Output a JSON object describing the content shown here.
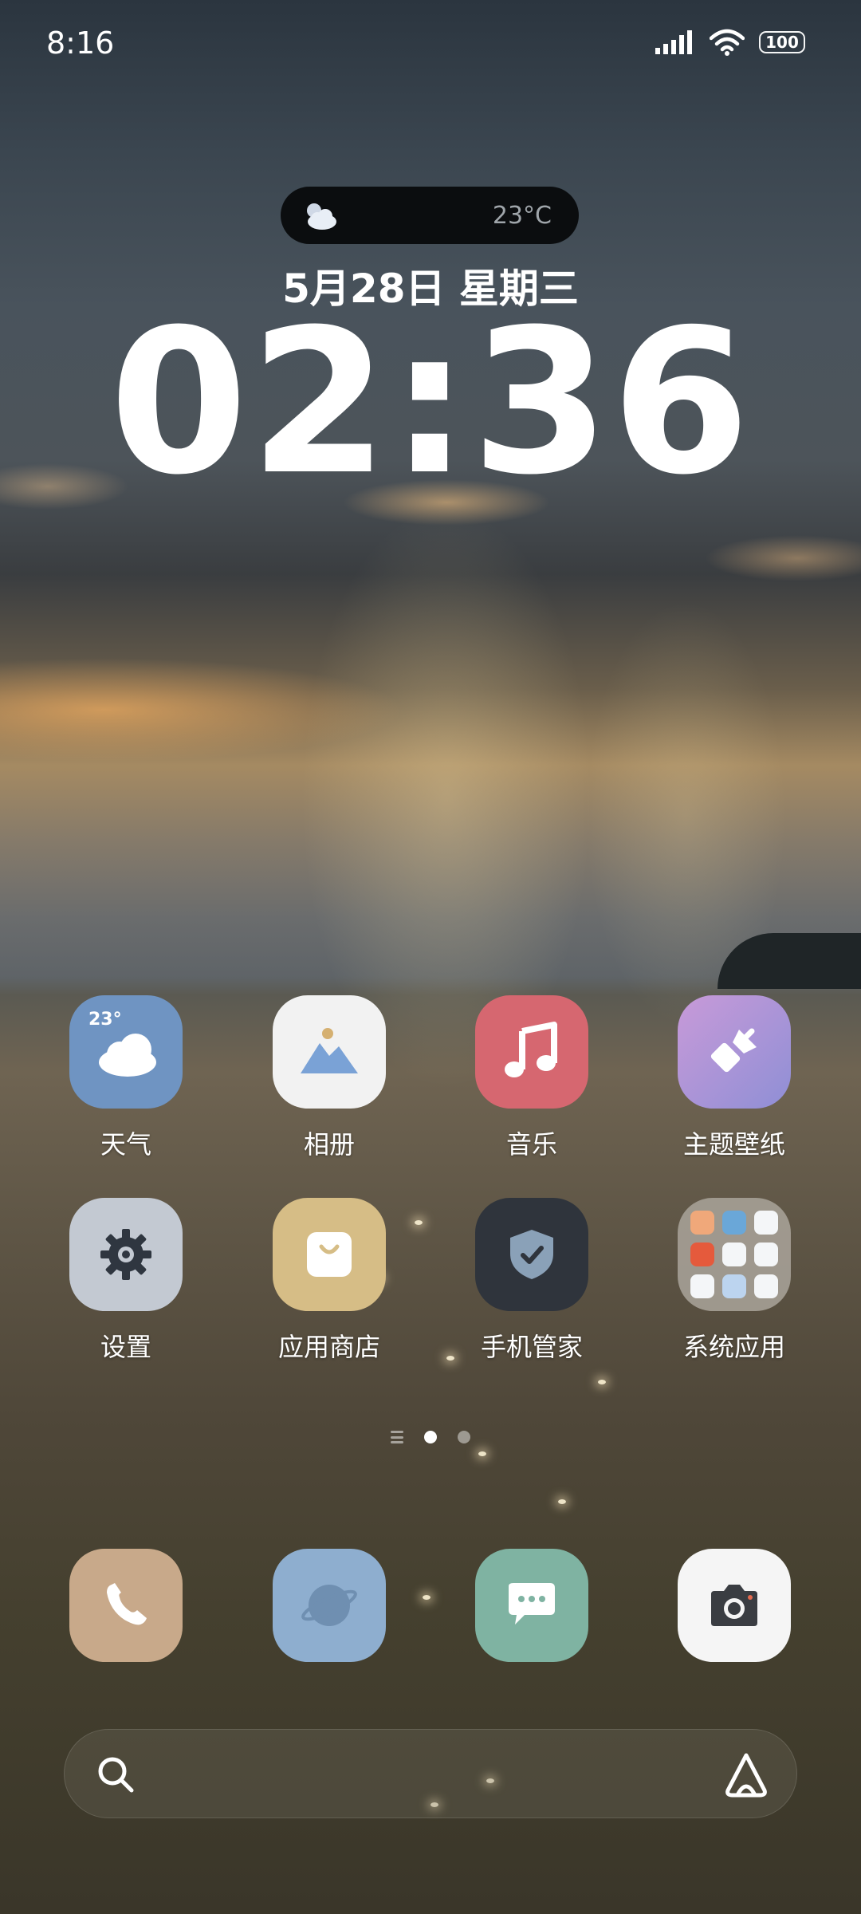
{
  "status_bar": {
    "time": "8:16",
    "battery": "100"
  },
  "lock_widget": {
    "temperature": "23°C",
    "date": "5月28日 星期三",
    "clock": "02:36"
  },
  "apps_row1": [
    {
      "label": "天气",
      "icon": "weather-icon",
      "badge": "23°",
      "color": "#6f94c2"
    },
    {
      "label": "相册",
      "icon": "gallery-icon",
      "color": "#f2f2f2"
    },
    {
      "label": "音乐",
      "icon": "music-icon",
      "color": "#d66770"
    },
    {
      "label": "主题壁纸",
      "icon": "themes-icon",
      "color": "#b08ed4"
    }
  ],
  "apps_row2": [
    {
      "label": "设置",
      "icon": "settings-icon",
      "color": "#c3c9d2"
    },
    {
      "label": "应用商店",
      "icon": "app-store-icon",
      "color": "#d6bd86"
    },
    {
      "label": "手机管家",
      "icon": "security-icon",
      "color": "#2f343c"
    },
    {
      "label": "系统应用",
      "icon": "folder-icon",
      "color": "#9d9890"
    }
  ],
  "dock": [
    {
      "icon": "phone-icon",
      "color": "#c8a98a"
    },
    {
      "icon": "browser-icon",
      "color": "#8eaecf"
    },
    {
      "icon": "messages-icon",
      "color": "#7fb3a2"
    },
    {
      "icon": "camera-icon",
      "color": "#f5f5f5"
    }
  ],
  "page_indicator": {
    "pages": 2,
    "active": 1
  }
}
